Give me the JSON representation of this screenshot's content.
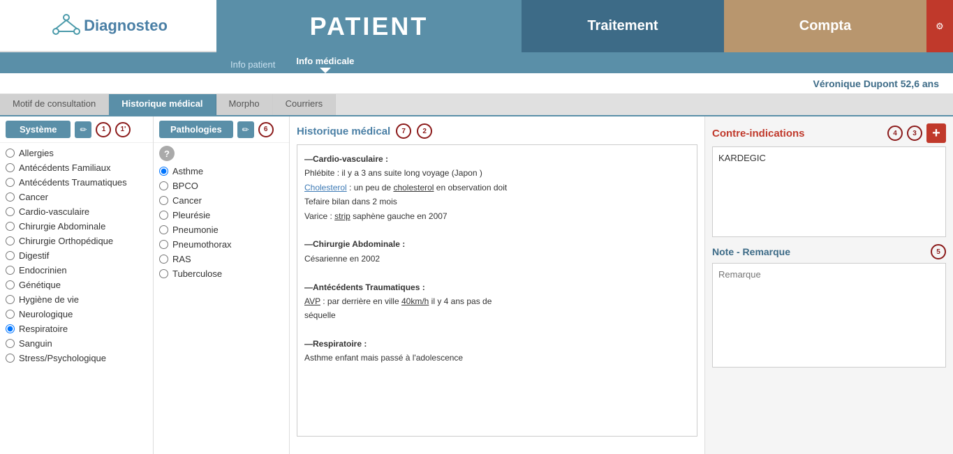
{
  "app": {
    "logo": "Diagnosteo",
    "nav": {
      "patient_label": "PATIENT",
      "traitement_label": "Traitement",
      "compta_label": "Compta",
      "info_patient": "Info patient",
      "info_medicale": "Info médicale"
    },
    "patient_name": "Véronique Dupont 52,6 ans"
  },
  "tabs": [
    {
      "label": "Motif de consultation",
      "active": false
    },
    {
      "label": "Historique médical",
      "active": true
    },
    {
      "label": "Morpho",
      "active": false
    },
    {
      "label": "Courriers",
      "active": false
    }
  ],
  "systeme": {
    "header": "Système",
    "items": [
      {
        "label": "Allergies",
        "selected": false
      },
      {
        "label": "Antécédents Familiaux",
        "selected": false
      },
      {
        "label": "Antécédents Traumatiques",
        "selected": false
      },
      {
        "label": "Cancer",
        "selected": false
      },
      {
        "label": "Cardio-vasculaire",
        "selected": false
      },
      {
        "label": "Chirurgie Abdominale",
        "selected": false
      },
      {
        "label": "Chirurgie Orthopédique",
        "selected": false
      },
      {
        "label": "Digestif",
        "selected": false
      },
      {
        "label": "Endocrinien",
        "selected": false
      },
      {
        "label": "Génétique",
        "selected": false
      },
      {
        "label": "Hygiène de vie",
        "selected": false
      },
      {
        "label": "Neurologique",
        "selected": false
      },
      {
        "label": "Respiratoire",
        "selected": true
      },
      {
        "label": "Sanguin",
        "selected": false
      },
      {
        "label": "Stress/Psychologique",
        "selected": false
      }
    ]
  },
  "pathologies": {
    "header": "Pathologies",
    "items": [
      {
        "label": "Asthme",
        "selected": true
      },
      {
        "label": "BPCO",
        "selected": false
      },
      {
        "label": "Cancer",
        "selected": false
      },
      {
        "label": "Pleurésie",
        "selected": false
      },
      {
        "label": "Pneumonie",
        "selected": false
      },
      {
        "label": "Pneumothorax",
        "selected": false
      },
      {
        "label": "RAS",
        "selected": false
      },
      {
        "label": "Tuberculose",
        "selected": false
      }
    ]
  },
  "historique": {
    "title": "Historique médical",
    "sections": [
      {
        "title": "—Cardio-vasculaire :",
        "lines": [
          "Phlébite : il y a 3 ans suite long voyage (Japon )",
          "Cholesterol : un peu de cholesterol en observation doit",
          "Tefaire bilan dans 2 mois",
          "Varice : strip saphène gauche en 2007"
        ]
      },
      {
        "title": "—Chirurgie Abdominale :",
        "lines": [
          "Césarienne en 2002"
        ]
      },
      {
        "title": "—Antécédents Traumatiques :",
        "lines": [
          "AVP : par derrière en ville 40km/h il y 4 ans pas de",
          "séquelle"
        ]
      },
      {
        "title": "—Respiratoire :",
        "lines": [
          "Asthme enfant mais passé à l'adolescence"
        ]
      }
    ]
  },
  "contre_indications": {
    "title": "Contre-indications",
    "content": "KARDEGIC",
    "add_label": "+"
  },
  "note_remarque": {
    "title": "Note - Remarque",
    "placeholder": "Remarque"
  },
  "annotations": {
    "numbers": [
      "1",
      "1'",
      "2",
      "3",
      "4",
      "5",
      "6",
      "7"
    ]
  }
}
